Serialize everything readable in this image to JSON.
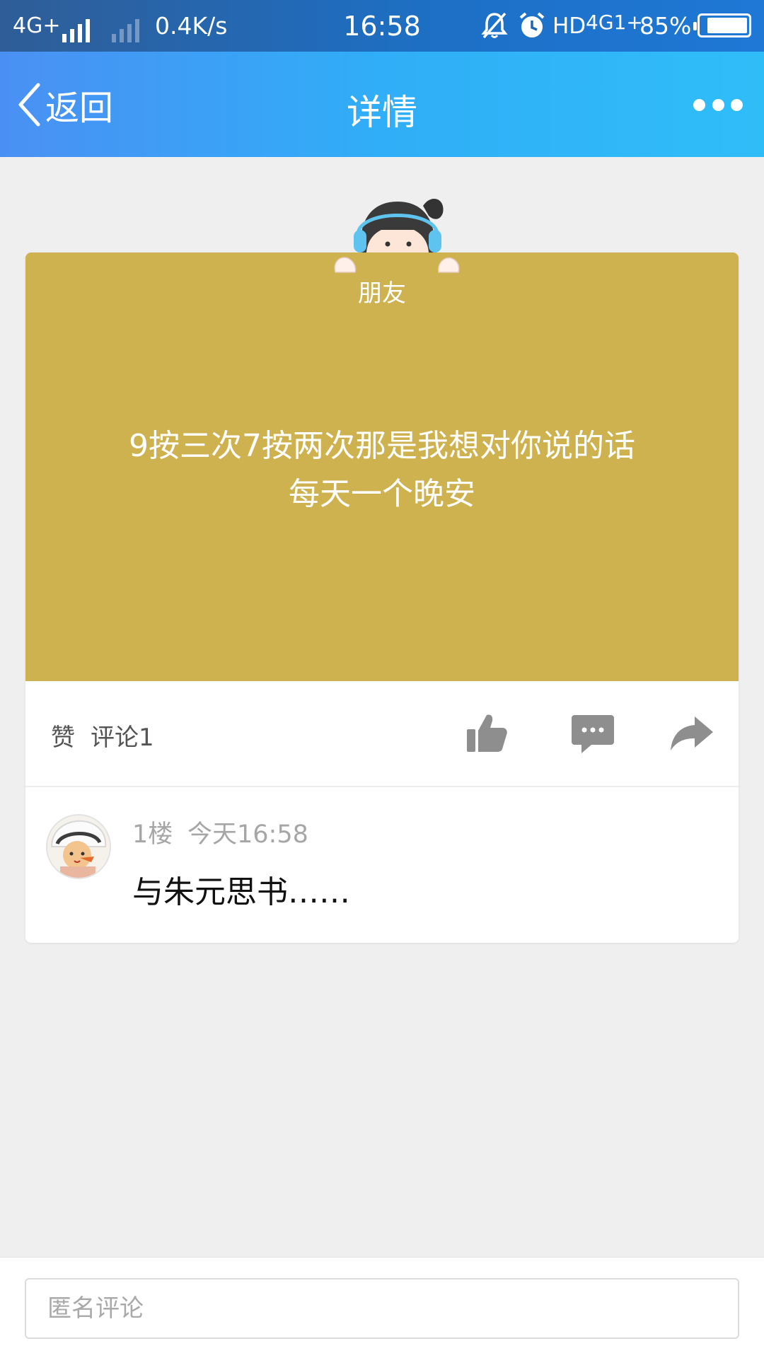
{
  "status_bar": {
    "network": "4G+",
    "speed": "0.4K/s",
    "time": "16:58",
    "hd": "HD",
    "network2": "4G1+",
    "battery": "85%"
  },
  "nav": {
    "back_label": "返回",
    "title": "详情"
  },
  "post": {
    "tag": "朋友",
    "text": "9按三次7按两次那是我想对你说的话\n每天一个晚安",
    "banner_color": "#ceb250"
  },
  "stats": {
    "like_label": "赞",
    "comment_label": "评论1"
  },
  "comments": [
    {
      "floor": "1楼",
      "time": "今天16:58",
      "text": "与朱元思书……"
    }
  ],
  "bottom": {
    "input_placeholder": "匿名评论"
  },
  "colors": {
    "nav_gradient_start": "#4a90f4",
    "nav_gradient_end": "#2fbdf8",
    "icon_gray": "#8e8e8e"
  }
}
